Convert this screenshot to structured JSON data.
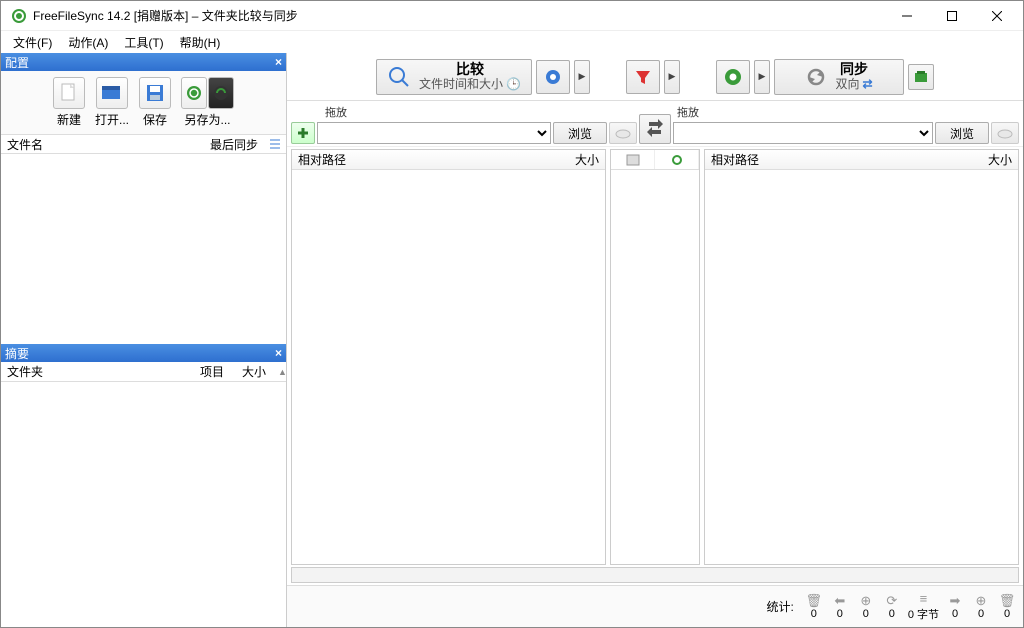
{
  "window": {
    "title": "FreeFileSync 14.2 [捐赠版本] – 文件夹比较与同步"
  },
  "menu": {
    "file": "文件(F)",
    "action": "动作(A)",
    "tools": "工具(T)",
    "help": "帮助(H)"
  },
  "config_panel": {
    "title": "配置",
    "new_label": "新建",
    "open_label": "打开...",
    "save_label": "保存",
    "saveas_label": "另存为...",
    "col_name": "文件名",
    "col_lastsync": "最后同步"
  },
  "summary_panel": {
    "title": "摘要",
    "col_folder": "文件夹",
    "col_items": "项目",
    "col_size": "大小"
  },
  "toolbar": {
    "compare": {
      "label": "比较",
      "sub": "文件时间和大小"
    },
    "sync": {
      "label": "同步",
      "sub": "双向"
    }
  },
  "pair": {
    "drop_left": "拖放",
    "drop_right": "拖放",
    "browse": "浏览"
  },
  "list": {
    "col_path": "相对路径",
    "col_size": "大小"
  },
  "status": {
    "label": "统计:",
    "cells": [
      {
        "icon": "disk",
        "value": "0"
      },
      {
        "icon": "arrow-left",
        "value": "0"
      },
      {
        "icon": "plus-left",
        "value": "0"
      },
      {
        "icon": "refresh",
        "value": "0"
      },
      {
        "icon": "bytes",
        "value": "0 字节"
      },
      {
        "icon": "arrow-right",
        "value": "0"
      },
      {
        "icon": "plus-right",
        "value": "0"
      },
      {
        "icon": "trash",
        "value": "0"
      }
    ]
  }
}
